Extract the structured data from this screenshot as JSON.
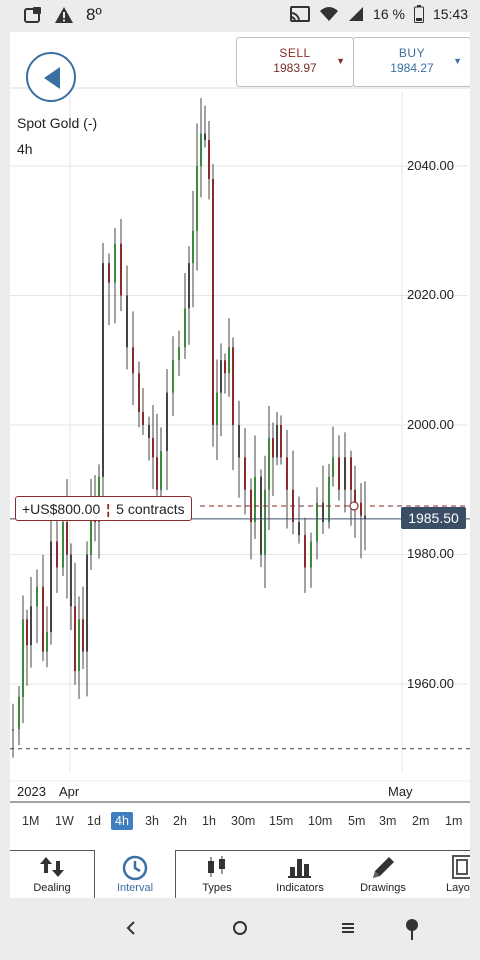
{
  "status_bar": {
    "temperature": "8º",
    "battery": "16 %",
    "time": "15:43",
    "icons": [
      "notification-icon",
      "alert-icon",
      "cast-icon",
      "wifi-icon",
      "signal-icon",
      "battery-icon"
    ]
  },
  "header": {
    "back_icon": "back-arrow-icon",
    "sell": {
      "label": "SELL",
      "price": "1983.97",
      "arrow": "▼"
    },
    "buy": {
      "label": "BUY",
      "price": "1984.27",
      "arrow": "▼"
    }
  },
  "instrument": {
    "name": "Spot Gold (-)",
    "interval": "4h"
  },
  "position": {
    "pnl": "+US$800.00",
    "separator": "¦",
    "contracts": "5 contracts",
    "current_price_tag": "1985.50"
  },
  "chart_data": {
    "type": "candlestick",
    "y_ticks": [
      "2040.00",
      "2020.00",
      "2000.00",
      "1980.00",
      "1960.00"
    ],
    "y_tick_values": [
      2040,
      2020,
      2000,
      1980,
      1960
    ],
    "ylim": [
      1945,
      2050
    ],
    "x_labels": [
      "2023",
      "Apr",
      "May"
    ],
    "current_price": 1985.5,
    "position_entry_level": 1987.5,
    "lower_dashed_level": 1950,
    "grid": true,
    "colors": {
      "up": "#3c8a3c",
      "down": "#8a2a2a",
      "neutral": "#444444",
      "price_tag_bg": "#3b4e66"
    }
  },
  "intervals": {
    "items": [
      "1M",
      "1W",
      "1d",
      "4h",
      "3h",
      "2h",
      "1h",
      "30m",
      "15m",
      "10m",
      "5m",
      "3m",
      "2m",
      "1m"
    ],
    "active": "4h"
  },
  "toolbar": {
    "items": [
      {
        "label": "Dealing",
        "icon": "dealing-icon"
      },
      {
        "label": "Interval",
        "icon": "clock-icon"
      },
      {
        "label": "Types",
        "icon": "candles-icon"
      },
      {
        "label": "Indicators",
        "icon": "bar-chart-icon"
      },
      {
        "label": "Drawings",
        "icon": "pencil-icon"
      },
      {
        "label": "Layo",
        "icon": "layout-icon"
      }
    ]
  },
  "nav_bar": {
    "icons": [
      "back-nav-icon",
      "home-nav-icon",
      "menu-nav-icon",
      "assistant-nav-icon"
    ]
  }
}
